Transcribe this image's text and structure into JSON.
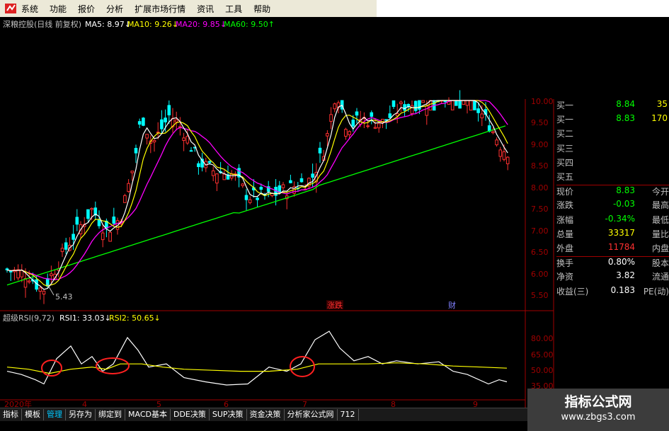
{
  "menu": [
    "系统",
    "功能",
    "报价",
    "分析",
    "扩展市场行情",
    "资讯",
    "工具",
    "帮助"
  ],
  "main_chart": {
    "title": "深粮控股(日线 前复权)",
    "ma_legend": [
      {
        "label": "MA5: 8.97↓",
        "color": "#ffffff"
      },
      {
        "label": "MA10: 9.26↓",
        "color": "#ffff00"
      },
      {
        "label": "MA20: 9.85↓",
        "color": "#ff00ff"
      },
      {
        "label": "MA60: 9.50↑",
        "color": "#00ff00"
      }
    ],
    "y_ticks": [
      "10.00",
      "9.50",
      "9.00",
      "8.50",
      "8.00",
      "7.50",
      "7.00",
      "6.50",
      "6.00",
      "5.50"
    ],
    "low_marker": "5.43",
    "event_labels": [
      {
        "text": "涨跌",
        "color": "#ff3030"
      },
      {
        "text": "财",
        "color": "#8080ff"
      }
    ]
  },
  "rsi": {
    "title": "超级RSI(9,72)",
    "rsi1_label": "RSI1: 33.03↓",
    "rsi2_label": "RSI2: 50.65↓",
    "y_ticks": [
      "80.00",
      "65.00",
      "50.00",
      "35.00"
    ]
  },
  "x_axis": [
    "2020年",
    "4",
    "5",
    "6",
    "7",
    "8",
    "9"
  ],
  "quote_panel": [
    {
      "label": "买一",
      "value": "8.84",
      "vcolor": "#00ff00",
      "extra": "35"
    },
    {
      "label": "买一",
      "value": "8.83",
      "vcolor": "#00ff00",
      "extra": "170"
    },
    {
      "label": "买二",
      "value": "",
      "vcolor": "#ffffff",
      "extra": ""
    },
    {
      "label": "买三",
      "value": "",
      "vcolor": "#ffffff",
      "extra": ""
    },
    {
      "label": "买四",
      "value": "",
      "vcolor": "#ffffff",
      "extra": ""
    },
    {
      "label": "买五",
      "value": "",
      "vcolor": "#ffffff",
      "extra": ""
    },
    {
      "label": "现价",
      "value": "8.83",
      "vcolor": "#00ff00",
      "label2": "今开"
    },
    {
      "label": "涨跌",
      "value": "-0.03",
      "vcolor": "#00ff00",
      "label2": "最高"
    },
    {
      "label": "涨幅",
      "value": "-0.34%",
      "vcolor": "#00ff00",
      "label2": "最低"
    },
    {
      "label": "总量",
      "value": "33317",
      "vcolor": "#ffff00",
      "label2": "量比"
    },
    {
      "label": "外盘",
      "value": "11784",
      "vcolor": "#ff3030",
      "label2": "内盘"
    },
    {
      "label": "换手",
      "value": "0.80%",
      "vcolor": "#ffffff",
      "label2": "股本"
    },
    {
      "label": "净资",
      "value": "3.82",
      "vcolor": "#ffffff",
      "label2": "流通"
    },
    {
      "label": "收益(三)",
      "value": "0.183",
      "vcolor": "#ffffff",
      "label2": "PE(动)"
    }
  ],
  "tabs": [
    "指标",
    "模板",
    "管理",
    "另存为",
    "绑定到",
    "MACD基本",
    "DDE决策",
    "SUP决策",
    "资金决策",
    "分析家公式网",
    "712"
  ],
  "watermark": {
    "title": "指标公式网",
    "url": "www.zbgs3.com"
  },
  "colors": {
    "up": "#ff3030",
    "down": "#00ffff",
    "ma5": "#ffffff",
    "ma10": "#ffff00",
    "ma20": "#ff00ff",
    "ma60": "#00ff00",
    "axis": "#a00000"
  }
}
